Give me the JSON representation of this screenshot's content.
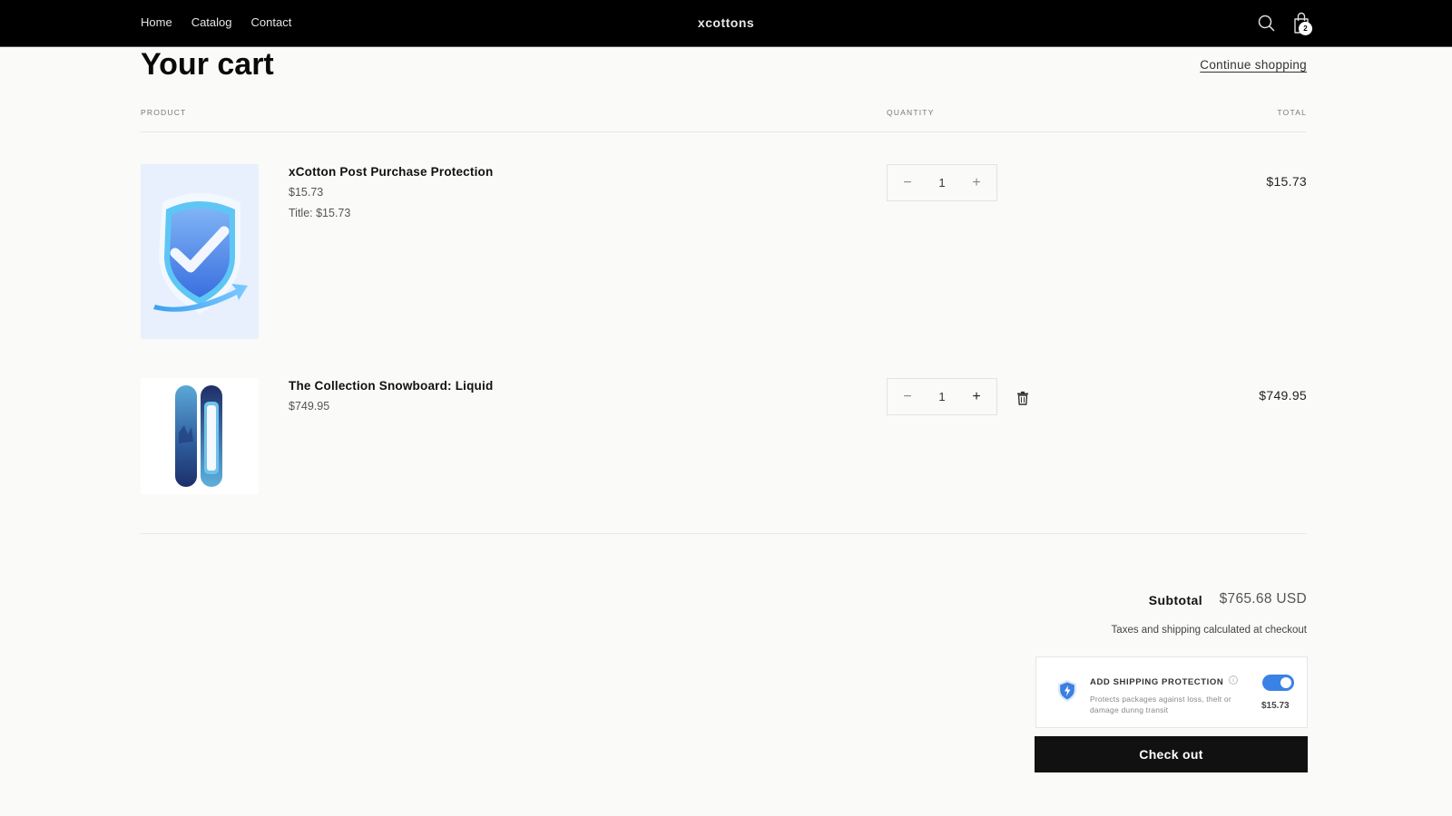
{
  "header": {
    "nav": [
      "Home",
      "Catalog",
      "Contact"
    ],
    "logo": "xcottons",
    "icons": {
      "search": "search-icon",
      "cart": "shopping-bag-icon"
    },
    "cart_count": "2"
  },
  "page": {
    "title": "Your cart",
    "continue_shopping": "Continue shopping"
  },
  "table": {
    "columns": [
      "PRODUCT",
      "QUANTITY",
      "TOTAL"
    ],
    "items": [
      {
        "name": "xCotton Post Purchase Protection",
        "price": "$15.73",
        "option": "Title: $15.73",
        "quantity": "1",
        "total": "$15.73",
        "image": "shield-checkmark-image"
      },
      {
        "name": "The Collection Snowboard: Liquid",
        "price": "$749.95",
        "quantity": "1",
        "total": "$749.95",
        "image": "snowboard-image",
        "remove_icon": "trash-icon"
      }
    ]
  },
  "summary": {
    "subtotal_label": "Subtotal",
    "subtotal_value": "$765.68 USD",
    "taxes_note": "Taxes and shipping calculated at checkout",
    "protection": {
      "title": "ADD SHIPPING PROTECTION",
      "info_icon": "i",
      "description": "Protects packages against loss, thelt or damage dunng transit",
      "price": "$15.73",
      "enabled": true
    },
    "checkout_label": "Check out"
  },
  "colors": {
    "header_bg": "#000000",
    "page_bg": "#fafaf9",
    "toggle_on": "#3b82e6",
    "checkout_bg": "#111111"
  }
}
